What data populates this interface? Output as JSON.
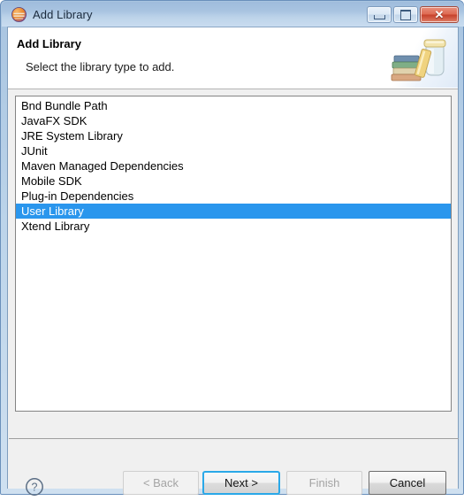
{
  "window": {
    "title": "Add Library",
    "app_icon": "eclipse-logo-icon",
    "controls": {
      "minimize_label": "Minimize",
      "maximize_label": "Maximize",
      "close_label": "Close",
      "close_glyph": "✕"
    }
  },
  "banner": {
    "title": "Add Library",
    "description": "Select the library type to add.",
    "art_icon": "library-jar-books-icon"
  },
  "library_list": {
    "selected_index": 7,
    "items": [
      {
        "label": "Bnd Bundle Path"
      },
      {
        "label": "JavaFX SDK"
      },
      {
        "label": "JRE System Library"
      },
      {
        "label": "JUnit"
      },
      {
        "label": "Maven Managed Dependencies"
      },
      {
        "label": "Mobile SDK"
      },
      {
        "label": "Plug-in Dependencies"
      },
      {
        "label": "User Library"
      },
      {
        "label": "Xtend Library"
      }
    ]
  },
  "buttonbar": {
    "help_icon": "help-question-icon",
    "buttons": [
      {
        "id": "back",
        "label": "< Back",
        "enabled": false,
        "focused": false
      },
      {
        "id": "next",
        "label": "Next >",
        "enabled": true,
        "focused": true
      },
      {
        "id": "finish",
        "label": "Finish",
        "enabled": false,
        "focused": false
      },
      {
        "id": "cancel",
        "label": "Cancel",
        "enabled": true,
        "focused": false
      }
    ]
  },
  "colors": {
    "selection_blue": "#2a96ed",
    "focus_ring": "#2aa8e8",
    "title_bar_blue": "#a9c4e1",
    "close_red": "#de6a52",
    "panel_grey": "#f0f0f0"
  }
}
